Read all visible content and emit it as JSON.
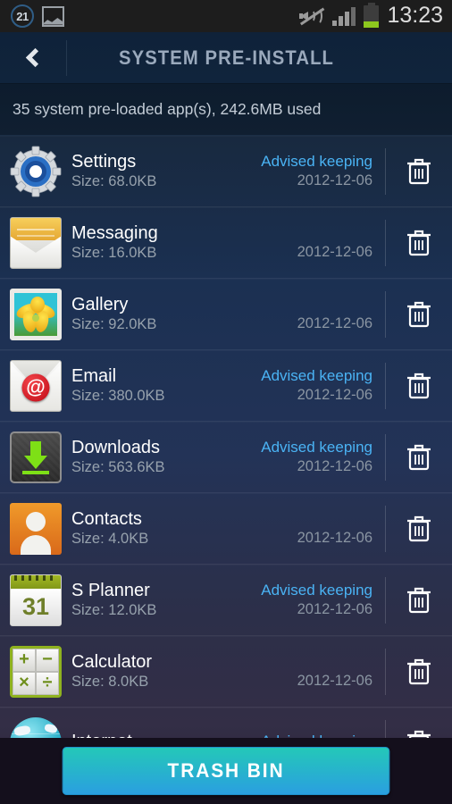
{
  "status_bar": {
    "notification_badge": "21",
    "gallery_icon": "gallery-icon",
    "mute_icon": "sound-muted-icon",
    "signal_icon": "signal-bars-icon",
    "battery_icon": "battery-icon",
    "time": "13:23"
  },
  "header": {
    "back_icon": "back-chevron-icon",
    "title": "SYSTEM PRE-INSTALL"
  },
  "summary": {
    "text": "35 system pre-loaded app(s), 242.6MB used"
  },
  "colors": {
    "advice_blue": "#4ab3f4",
    "title_gray": "#9aa9bc",
    "button_gradient_start": "#24c8b8",
    "button_gradient_end": "#2a9fe0",
    "battery_green": "#8dc71e"
  },
  "apps": [
    {
      "name": "Settings",
      "size": "Size: 68.0KB",
      "advice": "Advised keeping",
      "date": "2012-12-06",
      "icon": "settings-gear-icon",
      "delete_icon": "trash-icon"
    },
    {
      "name": "Messaging",
      "size": "Size: 16.0KB",
      "advice": "",
      "date": "2012-12-06",
      "icon": "messaging-envelope-icon",
      "delete_icon": "trash-icon"
    },
    {
      "name": "Gallery",
      "size": "Size: 92.0KB",
      "advice": "",
      "date": "2012-12-06",
      "icon": "gallery-flower-icon",
      "delete_icon": "trash-icon"
    },
    {
      "name": "Email",
      "size": "Size: 380.0KB",
      "advice": "Advised keeping",
      "date": "2012-12-06",
      "icon": "email-at-icon",
      "delete_icon": "trash-icon"
    },
    {
      "name": "Downloads",
      "size": "Size: 563.6KB",
      "advice": "Advised keeping",
      "date": "2012-12-06",
      "icon": "downloads-arrow-icon",
      "delete_icon": "trash-icon"
    },
    {
      "name": "Contacts",
      "size": "Size: 4.0KB",
      "advice": "",
      "date": "2012-12-06",
      "icon": "contacts-person-icon",
      "delete_icon": "trash-icon"
    },
    {
      "name": "S Planner",
      "size": "Size: 12.0KB",
      "advice": "Advised keeping",
      "date": "2012-12-06",
      "icon": "calendar-icon",
      "delete_icon": "trash-icon"
    },
    {
      "name": "Calculator",
      "size": "Size: 8.0KB",
      "advice": "",
      "date": "2012-12-06",
      "icon": "calculator-icon",
      "delete_icon": "trash-icon"
    },
    {
      "name": "Internet",
      "size": "",
      "advice": "Advised keeping",
      "date": "",
      "icon": "globe-icon",
      "delete_icon": "trash-icon"
    }
  ],
  "calculator_keys": [
    "+",
    "−",
    "×",
    "÷"
  ],
  "calendar_day": "31",
  "email_symbol": "@",
  "bottom": {
    "trash_bin_label": "TRASH BIN"
  }
}
